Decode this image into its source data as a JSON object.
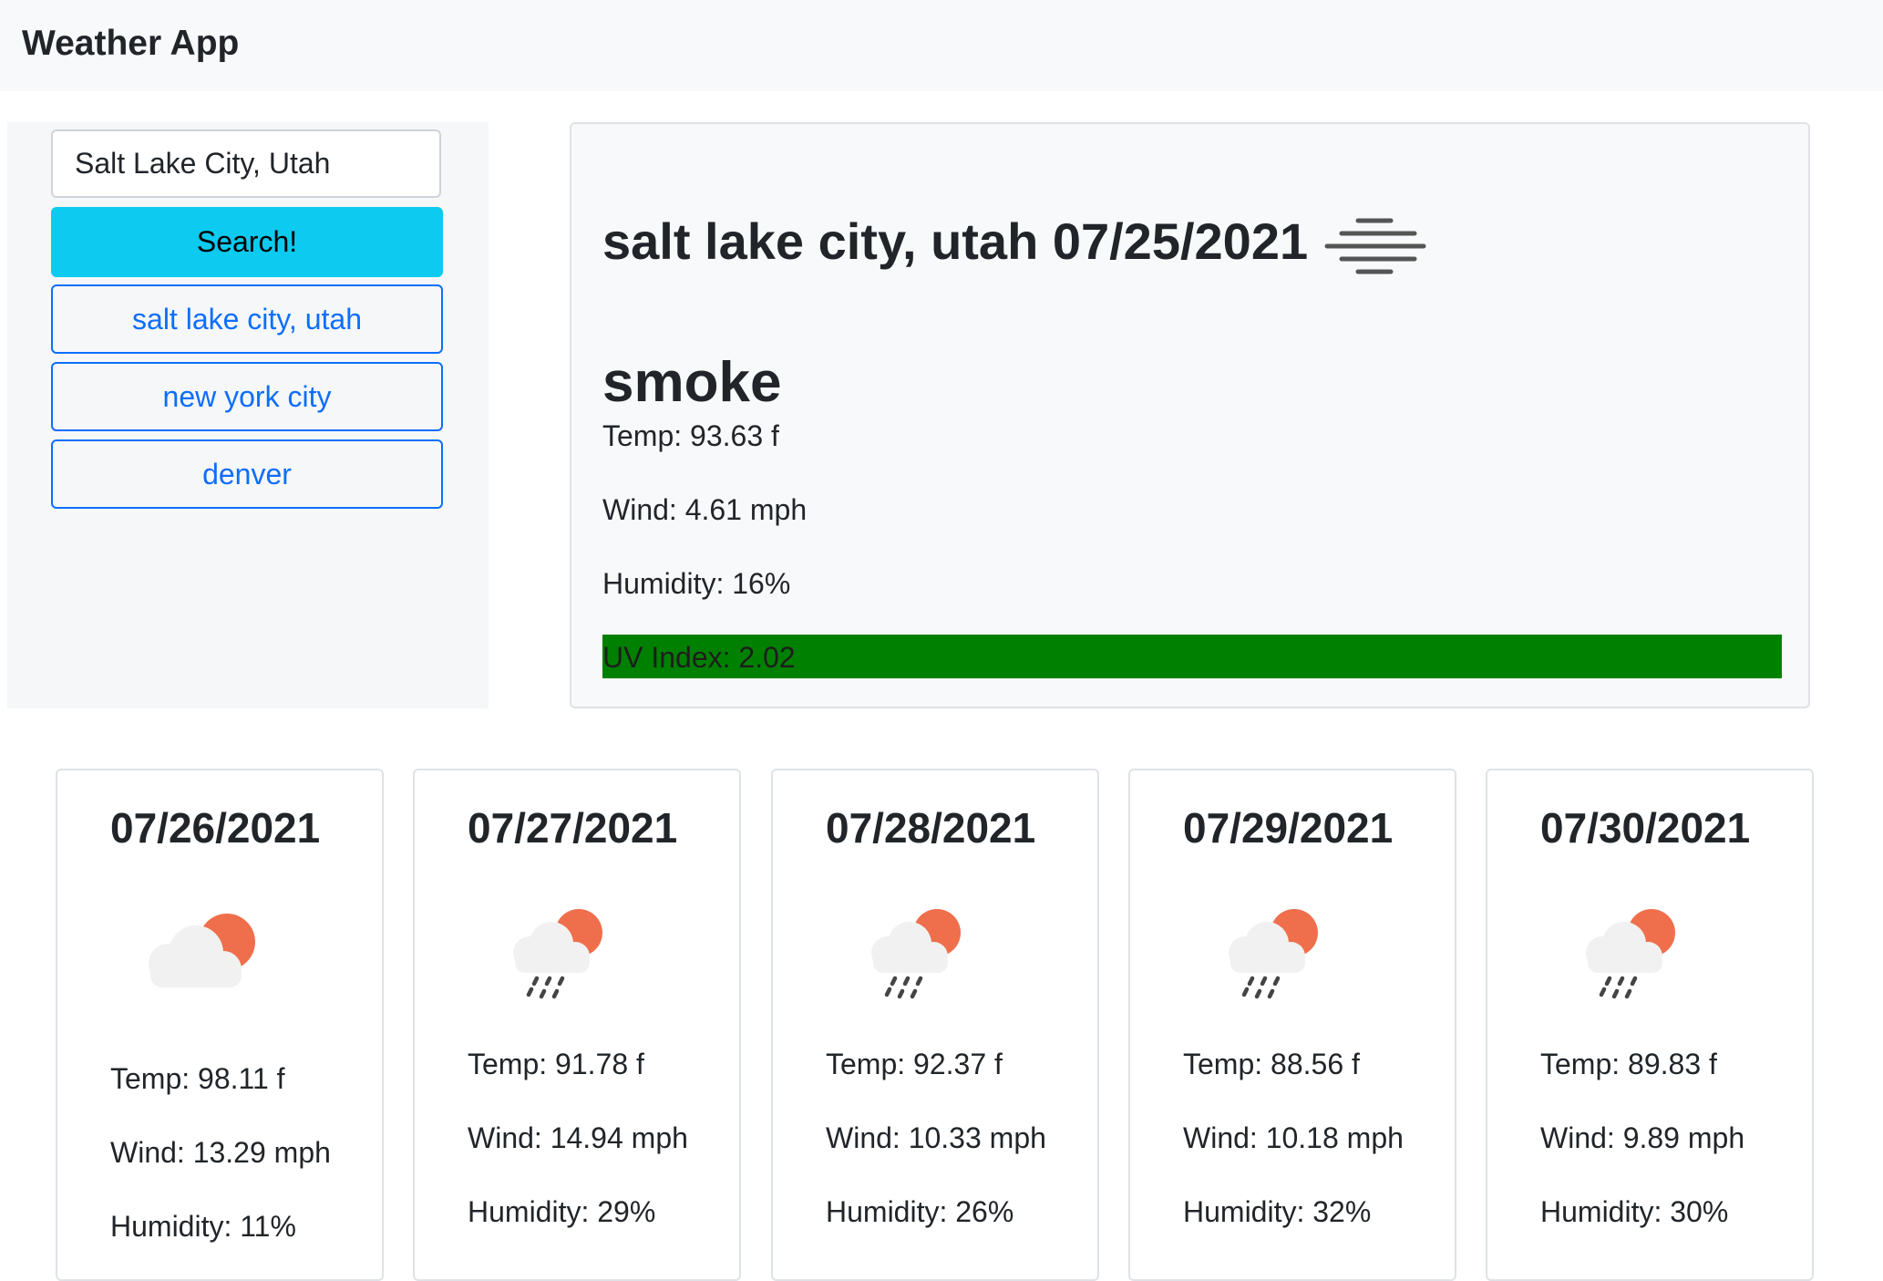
{
  "app": {
    "title": "Weather App"
  },
  "search": {
    "value": "Salt Lake City, Utah",
    "button_label": "Search!"
  },
  "history": [
    {
      "label": "salt lake city, utah"
    },
    {
      "label": "new york city"
    },
    {
      "label": "denver"
    }
  ],
  "current": {
    "title": "salt lake city, utah 07/25/2021",
    "icon": "smoke-haze-icon",
    "condition": "smoke",
    "temp": "Temp: 93.63 f",
    "wind": "Wind: 4.61 mph",
    "humidity": "Humidity: 16%",
    "uv": "UV Index: 2.02",
    "uv_color": "#008000"
  },
  "forecast": [
    {
      "date": "07/26/2021",
      "icon": "partly-cloudy-icon",
      "temp": "Temp: 98.11 f",
      "wind": "Wind: 13.29 mph",
      "humidity": "Humidity: 11%"
    },
    {
      "date": "07/27/2021",
      "icon": "rain-sun-icon",
      "temp": "Temp: 91.78 f",
      "wind": "Wind: 14.94 mph",
      "humidity": "Humidity: 29%"
    },
    {
      "date": "07/28/2021",
      "icon": "rain-sun-icon",
      "temp": "Temp: 92.37 f",
      "wind": "Wind: 10.33 mph",
      "humidity": "Humidity: 26%"
    },
    {
      "date": "07/29/2021",
      "icon": "rain-sun-icon",
      "temp": "Temp: 88.56 f",
      "wind": "Wind: 10.18 mph",
      "humidity": "Humidity: 32%"
    },
    {
      "date": "07/30/2021",
      "icon": "rain-sun-icon",
      "temp": "Temp: 89.83 f",
      "wind": "Wind: 9.89 mph",
      "humidity": "Humidity: 30%"
    }
  ],
  "colors": {
    "search_button": "#0dcaf0",
    "history_outline": "#0d6efd",
    "sun": "#ef6f4c",
    "cloud": "#f1f1f1"
  }
}
